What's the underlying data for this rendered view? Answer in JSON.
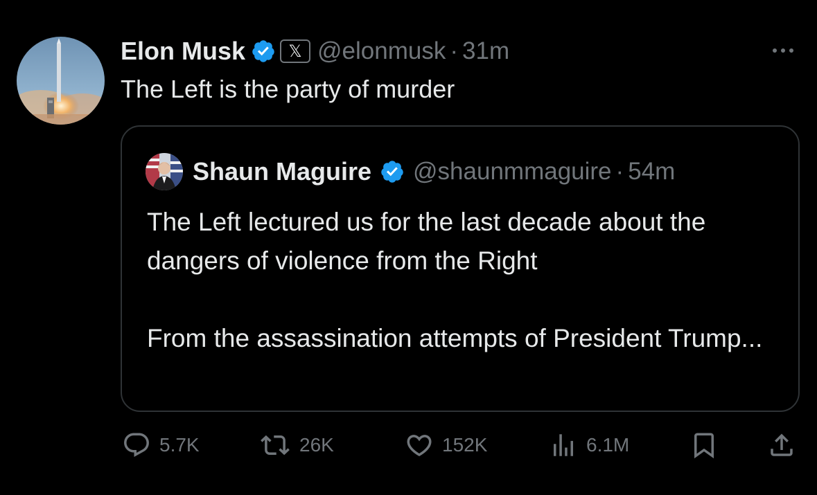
{
  "post": {
    "author_name": "Elon Musk",
    "x_badge": "𝕏",
    "handle": "@elonmusk",
    "separator": "·",
    "time": "31m",
    "text": "The Left is the party of murder"
  },
  "quote": {
    "author_name": "Shaun Maguire",
    "handle": "@shaunmmaguire",
    "separator": "·",
    "time": "54m",
    "paragraphs": [
      "The Left lectured us for the last decade about the dangers of violence from the Right",
      "From the assassination attempts of President Trump..."
    ]
  },
  "actions": {
    "replies": "5.7K",
    "reposts": "26K",
    "likes": "152K",
    "views": "6.1M"
  },
  "icons": {
    "verified": "verified-badge-icon",
    "more": "more-options-icon",
    "reply": "reply-icon",
    "repost": "repost-icon",
    "like": "heart-icon",
    "views": "views-chart-icon",
    "bookmark": "bookmark-icon",
    "share": "share-icon"
  },
  "colors": {
    "background": "#000000",
    "text": "#e7e9ea",
    "muted": "#71767b",
    "verified": "#1d9bf0",
    "border": "#2f3336"
  }
}
